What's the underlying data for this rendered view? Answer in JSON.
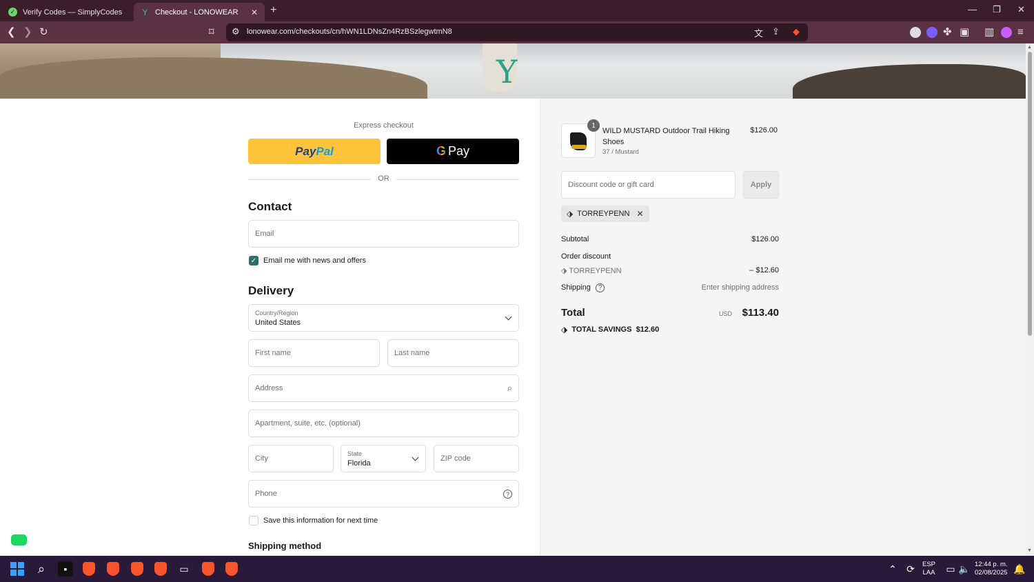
{
  "browser": {
    "tabs": [
      {
        "title": "Verify Codes — SimplyCodes",
        "active": false
      },
      {
        "title": "Checkout - LONOWEAR",
        "active": true
      }
    ],
    "url": "lonowear.com/checkouts/cn/hWN1LDNsZn4RzBSzlegwtmN8"
  },
  "express": {
    "label": "Express checkout",
    "paypal_part1": "Pay",
    "paypal_part2": "Pal",
    "gpay_label": "Pay",
    "or_label": "OR"
  },
  "contact": {
    "heading": "Contact",
    "email_placeholder": "Email",
    "news_label": "Email me with news and offers",
    "news_checked": true
  },
  "delivery": {
    "heading": "Delivery",
    "country_label": "Country/Region",
    "country_value": "United States",
    "first_name_placeholder": "First name",
    "last_name_placeholder": "Last name",
    "address_placeholder": "Address",
    "apartment_placeholder": "Apartment, suite, etc. (optional)",
    "city_placeholder": "City",
    "state_label": "State",
    "state_value": "Florida",
    "zip_placeholder": "ZIP code",
    "phone_placeholder": "Phone",
    "save_label": "Save this information for next time",
    "save_checked": false
  },
  "shipping_method": {
    "heading": "Shipping method"
  },
  "order": {
    "item": {
      "qty": "1",
      "name": "WILD MUSTARD Outdoor Trail Hiking Shoes",
      "variant": "37 / Mustard",
      "price": "$126.00"
    },
    "discount_placeholder": "Discount code or gift card",
    "apply_label": "Apply",
    "applied_code": "TORREYPENN",
    "subtotal_label": "Subtotal",
    "subtotal_value": "$126.00",
    "order_discount_label": "Order discount",
    "discount_code": "TORREYPENN",
    "discount_value": "– $12.60",
    "shipping_label": "Shipping",
    "shipping_value": "Enter shipping address",
    "total_label": "Total",
    "currency": "USD",
    "total_value": "$113.40",
    "savings_label": "TOTAL SAVINGS",
    "savings_value": "$12.60"
  },
  "taskbar": {
    "lang_top": "ESP",
    "lang_bottom": "LAA",
    "time": "12:44 p. m.",
    "date": "02/08/2025"
  },
  "colors": {
    "tabbar": "#3a1f2b",
    "toolbar": "#5a3242",
    "paypal_yellow": "#ffc439",
    "checkbox_green": "#2f6f6a",
    "summary_bg": "#f5f5f5"
  }
}
